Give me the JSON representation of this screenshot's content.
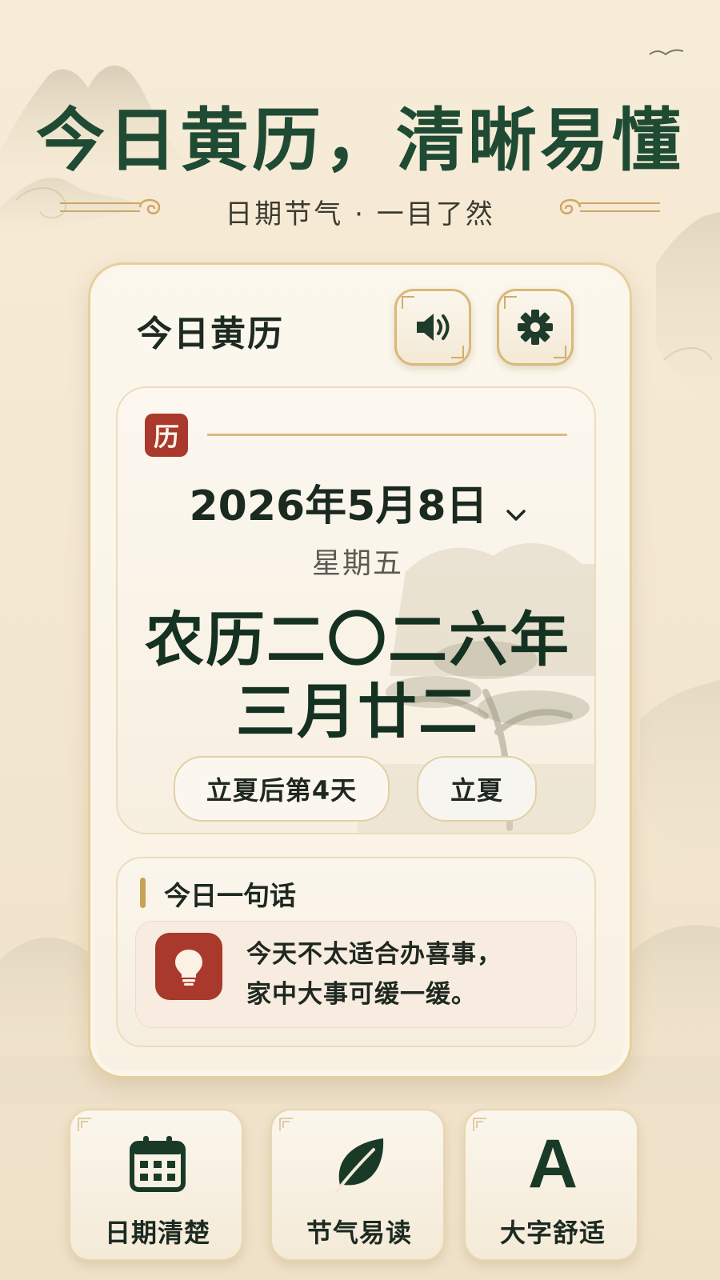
{
  "hero": {
    "title": "今日黄历，清晰易懂",
    "subtitle": "日期节气 · 一目了然"
  },
  "card": {
    "title": "今日黄历",
    "sound_icon": "speaker-icon",
    "settings_icon": "gear-icon"
  },
  "date_panel": {
    "badge": "历",
    "solar_date": "2026年5月8日",
    "weekday": "星期五",
    "lunar_line1": "农历二〇二六年",
    "lunar_line2": "三月廿二",
    "term_offset": "立夏后第4天",
    "term_name": "立夏"
  },
  "saying": {
    "title": "今日一句话",
    "line1": "今天不太适合办喜事，",
    "line2": "家中大事可缓一缓。",
    "icon": "lightbulb-icon"
  },
  "features": [
    {
      "label": "日期清楚",
      "icon": "calendar-icon"
    },
    {
      "label": "节气易读",
      "icon": "leaf-icon"
    },
    {
      "label": "大字舒适",
      "icon": "large-text-icon",
      "glyph": "A"
    }
  ],
  "colors": {
    "primary_green": "#1f4a33",
    "accent_red": "#a8392c",
    "gold": "#d9b978",
    "background": "#f5e9d3"
  }
}
